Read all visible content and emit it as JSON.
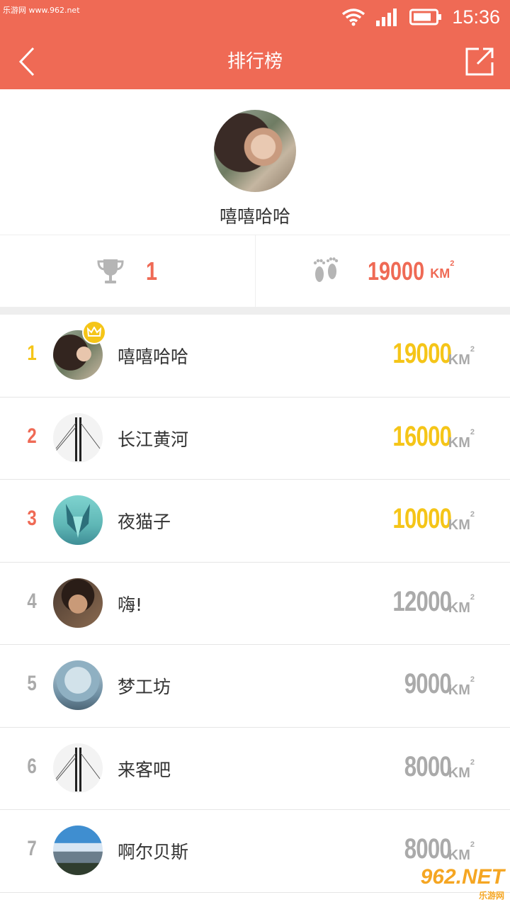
{
  "watermark_top": "乐游网 www.962.net",
  "status_bar": {
    "time": "15:36"
  },
  "header": {
    "title": "排行榜"
  },
  "profile": {
    "name": "嘻嘻哈哈"
  },
  "stats": {
    "rank": "1",
    "distance": "19000",
    "unit": "KM",
    "unit_sup": "2"
  },
  "leaderboard": [
    {
      "rank": "1",
      "name": "嘻嘻哈哈",
      "distance": "19000",
      "color": "#f5c518",
      "rank_color": "#f5c518",
      "avatar": "girl"
    },
    {
      "rank": "2",
      "name": "长江黄河",
      "distance": "16000",
      "color": "#f5c518",
      "rank_color": "#ef6a55",
      "avatar": "bridge"
    },
    {
      "rank": "3",
      "name": "夜猫子",
      "distance": "10000",
      "color": "#f5c518",
      "rank_color": "#ef6a55",
      "avatar": "cat"
    },
    {
      "rank": "4",
      "name": "嗨!",
      "distance": "12000",
      "color": "#aaaaaa",
      "rank_color": "#aaaaaa",
      "avatar": "man"
    },
    {
      "rank": "5",
      "name": "梦工坊",
      "distance": "9000",
      "color": "#aaaaaa",
      "rank_color": "#aaaaaa",
      "avatar": "tree"
    },
    {
      "rank": "6",
      "name": "来客吧",
      "distance": "8000",
      "color": "#aaaaaa",
      "rank_color": "#aaaaaa",
      "avatar": "bridge"
    },
    {
      "rank": "7",
      "name": "啊尔贝斯",
      "distance": "8000",
      "color": "#aaaaaa",
      "rank_color": "#aaaaaa",
      "avatar": "mountain"
    }
  ],
  "unit": "KM",
  "unit_sup": "2",
  "watermark_bottom": {
    "main": "962.NET",
    "sub": "乐游网"
  },
  "colors": {
    "accent": "#ef6a55",
    "gold": "#f5c518",
    "grey": "#aaaaaa"
  }
}
